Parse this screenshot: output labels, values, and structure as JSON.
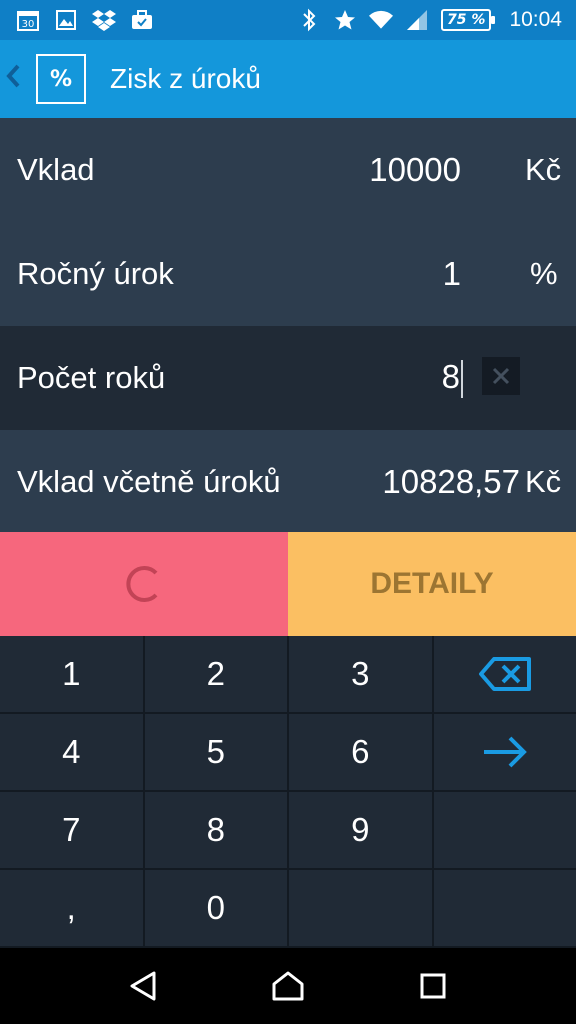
{
  "status_bar": {
    "date_icon_text": "30",
    "battery": "75 %",
    "time": "10:04",
    "icons": [
      "calendar-icon",
      "image-icon",
      "dropbox-icon",
      "briefcase-icon",
      "bluetooth-icon",
      "star-icon",
      "wifi-icon",
      "signal-icon",
      "battery-icon"
    ]
  },
  "app_bar": {
    "logo": "%",
    "title": "Zisk z úroků"
  },
  "form": {
    "rows": [
      {
        "label": "Vklad",
        "value": "10000",
        "unit": "Kč"
      },
      {
        "label": "Ročný úrok",
        "value": "1",
        "unit": "%"
      },
      {
        "label": "Počet roků",
        "value": "8"
      },
      {
        "label": "Vklad včetně úroků",
        "value": "10828,57",
        "unit": "Kč"
      }
    ]
  },
  "actions": {
    "detail_label": "DETAILY"
  },
  "keypad": {
    "keys": [
      "1",
      "2",
      "3",
      "",
      "4",
      "5",
      "6",
      "",
      "7",
      "8",
      "9",
      "",
      ",",
      "0",
      "",
      ""
    ]
  },
  "colors": {
    "status_bar": "#0f7fc6",
    "app_bar": "#1497db",
    "reset": "#f6677d",
    "detail": "#fbbf62",
    "accent": "#1a9be3"
  }
}
